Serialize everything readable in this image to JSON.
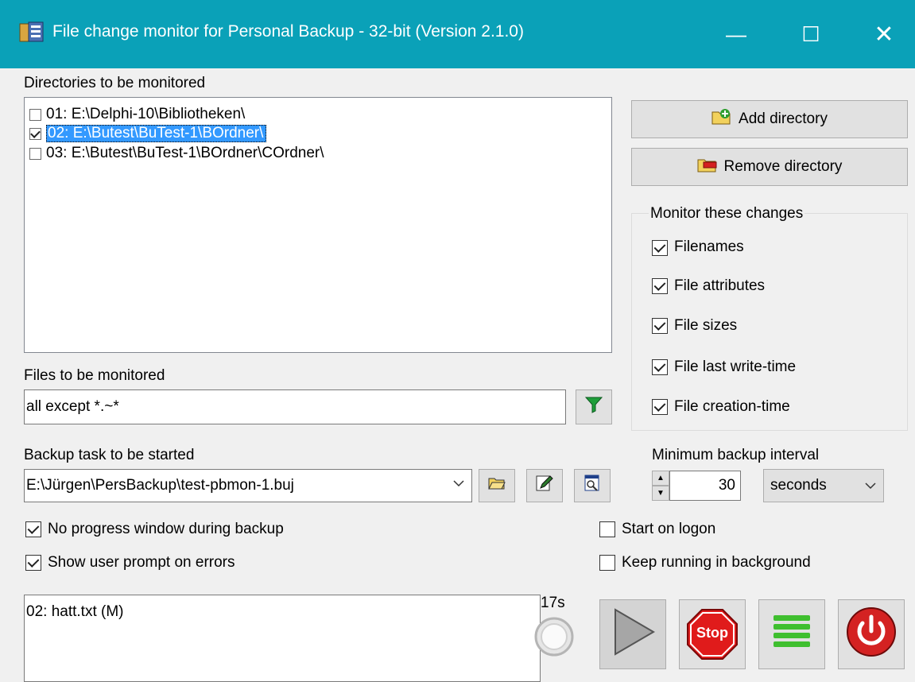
{
  "window": {
    "title": "File change monitor for Personal Backup - 32-bit (Version 2.1.0)",
    "min_glyph": "—",
    "max_glyph": "☐",
    "close_glyph": "✕"
  },
  "directories": {
    "label": "Directories to be monitored",
    "items": [
      {
        "text": "01: E:\\Delphi-10\\Bibliotheken\\",
        "checked": false,
        "selected": false
      },
      {
        "text": "02: E:\\Butest\\BuTest-1\\BOrdner\\",
        "checked": true,
        "selected": true
      },
      {
        "text": "03: E:\\Butest\\BuTest-1\\BOrdner\\COrdner\\",
        "checked": false,
        "selected": false
      }
    ],
    "add_label": "Add directory",
    "remove_label": "Remove directory"
  },
  "monitor": {
    "label": "Monitor these changes",
    "options": [
      {
        "label": "Filenames",
        "checked": true
      },
      {
        "label": "File attributes",
        "checked": true
      },
      {
        "label": "File sizes",
        "checked": true
      },
      {
        "label": "File last write-time",
        "checked": true
      },
      {
        "label": "File creation-time",
        "checked": true
      }
    ]
  },
  "files": {
    "label": "Files to be monitored",
    "value": "all except *.~*"
  },
  "task": {
    "label": "Backup task to be started",
    "value": "E:\\Jürgen\\PersBackup\\test-pbmon-1.buj"
  },
  "interval": {
    "label": "Minimum backup interval",
    "value": "30",
    "unit": "seconds"
  },
  "options": {
    "no_progress": {
      "label": "No progress window during backup",
      "checked": true
    },
    "user_prompt": {
      "label": "Show user prompt on errors",
      "checked": true
    },
    "start_logon": {
      "label": "Start on logon",
      "checked": false
    },
    "keep_running": {
      "label": "Keep running in background",
      "checked": false
    }
  },
  "log": {
    "lines": [
      "02: hatt.txt (M)"
    ]
  },
  "status": {
    "countdown": "17s"
  },
  "controls": {
    "stop_label": "Stop"
  },
  "colors": {
    "titlebar": "#0aa1b8",
    "selection": "#3399ff"
  }
}
